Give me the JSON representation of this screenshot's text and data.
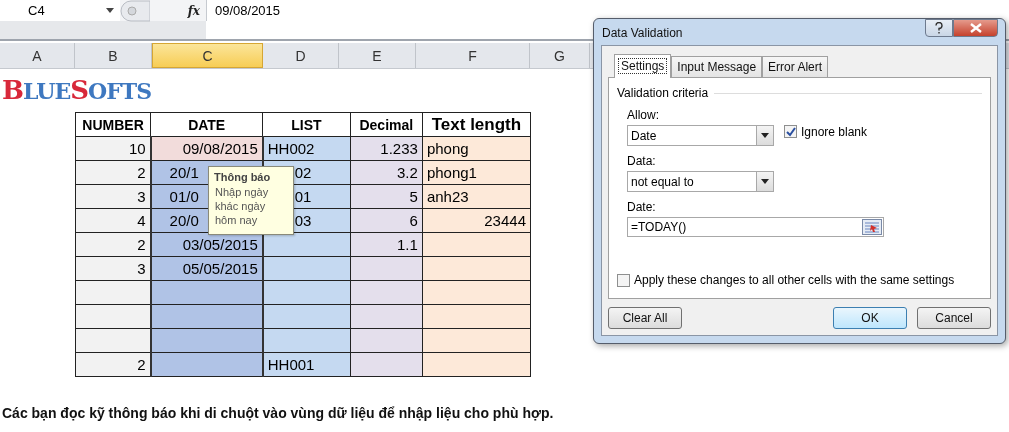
{
  "formula_bar": {
    "name_box": "C4",
    "function_label": "fx",
    "formula": "09/08/2015"
  },
  "column_headers": [
    {
      "label": "A",
      "selected": false
    },
    {
      "label": "B",
      "selected": false
    },
    {
      "label": "C",
      "selected": true
    },
    {
      "label": "D",
      "selected": false
    },
    {
      "label": "E",
      "selected": false
    },
    {
      "label": "F",
      "selected": false
    },
    {
      "label": "G",
      "selected": false
    }
  ],
  "logo": {
    "text": "BLUESOFTS"
  },
  "table": {
    "columns": [
      "NUMBER",
      "DATE",
      "LIST",
      "Decimal",
      "Text length"
    ],
    "rows": [
      [
        {
          "text": "10",
          "kind": "number"
        },
        {
          "text": "09/08/2015",
          "kind": "number",
          "active": true
        },
        {
          "text": "HH002",
          "kind": "text"
        },
        {
          "text": "1.233",
          "kind": "number"
        },
        {
          "text": "phong",
          "kind": "text"
        }
      ],
      [
        {
          "text": "2",
          "kind": "number"
        },
        {
          "text": "20/1",
          "kind": "partial",
          "active": false
        },
        {
          "text": "02",
          "kind": "partial"
        },
        {
          "text": "3.2",
          "kind": "number"
        },
        {
          "text": "phong1",
          "kind": "text"
        }
      ],
      [
        {
          "text": "3",
          "kind": "number"
        },
        {
          "text": "01/0",
          "kind": "partial",
          "active": false
        },
        {
          "text": "01",
          "kind": "partial"
        },
        {
          "text": "5",
          "kind": "number"
        },
        {
          "text": "anh23",
          "kind": "text"
        }
      ],
      [
        {
          "text": "4",
          "kind": "number"
        },
        {
          "text": "20/0",
          "kind": "partial",
          "active": false
        },
        {
          "text": "03",
          "kind": "partial"
        },
        {
          "text": "6",
          "kind": "number"
        },
        {
          "text": "23444",
          "kind": "number"
        }
      ],
      [
        {
          "text": "2",
          "kind": "number"
        },
        {
          "text": "03/05/2015",
          "kind": "number",
          "active": false
        },
        {},
        {
          "text": "1.1",
          "kind": "number"
        },
        {}
      ],
      [
        {
          "text": "3",
          "kind": "number"
        },
        {
          "text": "05/05/2015",
          "kind": "number",
          "active": false
        },
        {},
        {},
        {}
      ],
      [
        {},
        {
          "active": false
        },
        {},
        {},
        {}
      ],
      [
        {},
        {
          "active": false
        },
        {},
        {},
        {}
      ],
      [
        {},
        {
          "active": false
        },
        {},
        {},
        {}
      ],
      [
        {
          "text": "2",
          "kind": "number"
        },
        {
          "active": false
        },
        {
          "text": "HH001",
          "kind": "text"
        },
        {},
        {}
      ]
    ]
  },
  "tooltip": {
    "title": "Thông báo",
    "lines": [
      "Nhập ngày",
      "khác ngày",
      "hôm nay"
    ]
  },
  "caption": "Các bạn đọc kỹ thông báo khi di chuột vào vùng dữ liệu để nhập liệu cho phù hợp.",
  "dialog": {
    "title": "Data Validation",
    "tabs": [
      {
        "label": "Settings",
        "selected": true
      },
      {
        "label": "Input Message",
        "selected": false
      },
      {
        "label": "Error Alert",
        "selected": false
      }
    ],
    "group_title": "Validation criteria",
    "allow": {
      "label": "Allow:",
      "value": "Date"
    },
    "ignore_blank": {
      "label": "Ignore blank",
      "checked": true
    },
    "data": {
      "label": "Data:",
      "value": "not equal to"
    },
    "date": {
      "label": "Date:",
      "value": "=TODAY()"
    },
    "apply_all": {
      "label": "Apply these changes to all other cells with the same settings",
      "checked": false
    },
    "buttons": [
      {
        "label": "Clear All",
        "default": false
      },
      {
        "label": "OK",
        "default": true
      },
      {
        "label": "Cancel",
        "default": false
      }
    ]
  }
}
